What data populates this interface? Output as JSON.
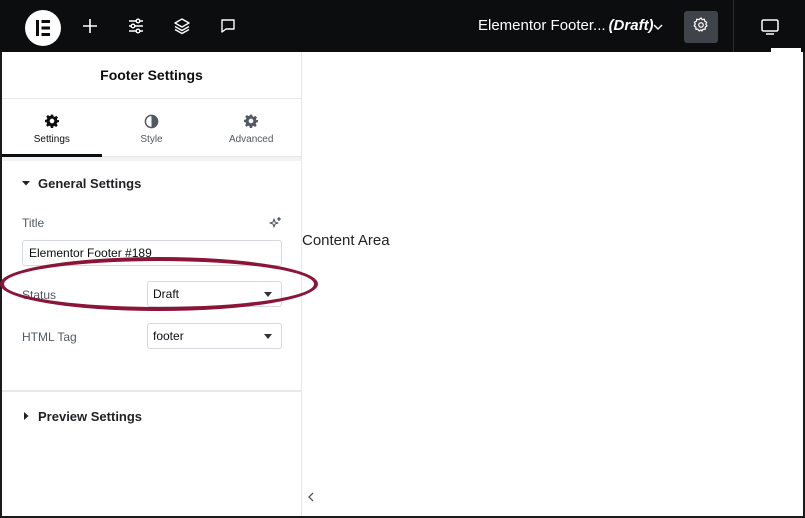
{
  "topbar": {
    "logo_icon": "elementor-logo",
    "add_icon": "plus-icon",
    "settings_icon": "sliders-icon",
    "layers_icon": "layers-icon",
    "comments_icon": "comment-icon",
    "document_title": "Elementor Footer...",
    "document_status": "(Draft)",
    "page_settings_icon": "gear-icon",
    "responsive_icon": "desktop-icon",
    "dark_color": "#0c0d0e",
    "active_button_color": "#3f444b"
  },
  "panel": {
    "title": "Footer Settings",
    "tabs": [
      {
        "label": "Settings",
        "icon": "gear-icon",
        "active": true
      },
      {
        "label": "Style",
        "icon": "half-circle-icon",
        "active": false
      },
      {
        "label": "Advanced",
        "icon": "gear-icon",
        "active": false
      }
    ],
    "general_section": {
      "label": "General Settings",
      "expanded": true,
      "title_label": "Title",
      "title_value": "Elementor Footer #189",
      "status_label": "Status",
      "status_value": "Draft",
      "html_tag_label": "HTML Tag",
      "html_tag_value": "footer"
    },
    "preview_section": {
      "label": "Preview Settings",
      "expanded": false
    }
  },
  "canvas": {
    "content_label": "Content Area"
  },
  "highlight_color": "#8a1538"
}
